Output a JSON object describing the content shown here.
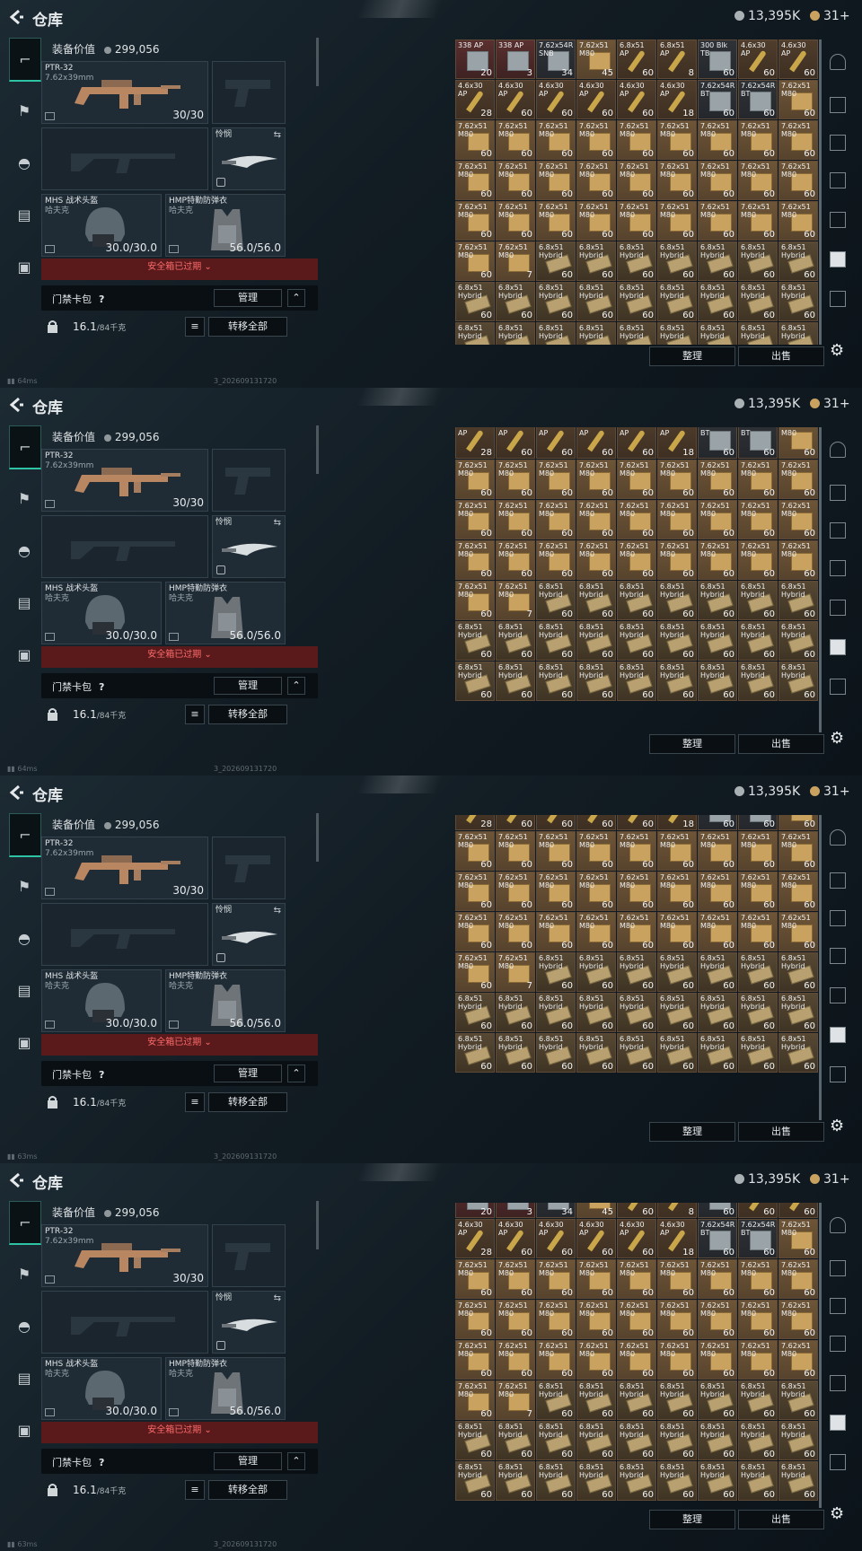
{
  "app": {
    "title": "仓库",
    "silver": "13,395K",
    "gold": "31+"
  },
  "loadout": {
    "value_label": "装备价值",
    "value": "299,056",
    "primary": {
      "name": "PTR-32",
      "caliber": "7.62x39mm",
      "ammo": "30/30"
    },
    "melee": {
      "name": "怜悯"
    },
    "helmet": {
      "name": "MHS 战术头盔",
      "sub": "哈夫克",
      "dur": "30.0/30.0"
    },
    "armor": {
      "name": "HMP特勤防弹衣",
      "sub": "哈夫克",
      "dur": "56.0/56.0"
    },
    "safe_box_text": "安全箱已过期",
    "card_pack": "门禁卡包",
    "help": "?",
    "manage_button": "管理",
    "weight": "16.1",
    "weight_cap": "/84千克",
    "transfer_all_button": "转移全部"
  },
  "stash": {
    "sort_button": "整理",
    "sell_button": "出售"
  },
  "status": {
    "pings": [
      "64ms",
      "64ms",
      "63ms",
      "63ms"
    ],
    "build": "3_202609131720"
  },
  "colors": {
    "accent": "#2ec3a5",
    "warning": "#ff6a6a",
    "crate": "#c9a260"
  },
  "panels": [
    {
      "grid_offset_rows": 0
    },
    {
      "grid_offset_rows": 1.2
    },
    {
      "grid_offset_rows": 1.6
    },
    {
      "grid_offset_rows": 0.6
    }
  ],
  "grid_rows": [
    [
      [
        "338 AP",
        "20",
        "red"
      ],
      [
        "338 AP",
        "3",
        "red"
      ],
      [
        "7.62x54R SNB",
        "34",
        "can"
      ],
      [
        "7.62x51 M80",
        "45",
        "box"
      ],
      [
        "6.8x51 AP",
        "60",
        "ap"
      ],
      [
        "6.8x51 AP",
        "8",
        "ap"
      ],
      [
        "300 Blk TB",
        "60",
        "can"
      ],
      [
        "4.6x30 AP",
        "60",
        "ap"
      ],
      [
        "4.6x30 AP",
        "60",
        "ap"
      ]
    ],
    [
      [
        "4.6x30 AP",
        "28",
        "ap"
      ],
      [
        "4.6x30 AP",
        "60",
        "ap"
      ],
      [
        "4.6x30 AP",
        "60",
        "ap"
      ],
      [
        "4.6x30 AP",
        "60",
        "ap"
      ],
      [
        "4.6x30 AP",
        "60",
        "ap"
      ],
      [
        "4.6x30 AP",
        "18",
        "ap"
      ],
      [
        "7.62x54R BT",
        "60",
        "can"
      ],
      [
        "7.62x54R BT",
        "60",
        "can"
      ],
      [
        "7.62x51 M80",
        "60",
        "box"
      ]
    ],
    [
      [
        "7.62x51 M80",
        "60",
        "box"
      ],
      [
        "7.62x51 M80",
        "60",
        "box"
      ],
      [
        "7.62x51 M80",
        "60",
        "box"
      ],
      [
        "7.62x51 M80",
        "60",
        "box"
      ],
      [
        "7.62x51 M80",
        "60",
        "box"
      ],
      [
        "7.62x51 M80",
        "60",
        "box"
      ],
      [
        "7.62x51 M80",
        "60",
        "box"
      ],
      [
        "7.62x51 M80",
        "60",
        "box"
      ],
      [
        "7.62x51 M80",
        "60",
        "box"
      ]
    ],
    [
      [
        "7.62x51 M80",
        "60",
        "box"
      ],
      [
        "7.62x51 M80",
        "60",
        "box"
      ],
      [
        "7.62x51 M80",
        "60",
        "box"
      ],
      [
        "7.62x51 M80",
        "60",
        "box"
      ],
      [
        "7.62x51 M80",
        "60",
        "box"
      ],
      [
        "7.62x51 M80",
        "60",
        "box"
      ],
      [
        "7.62x51 M80",
        "60",
        "box"
      ],
      [
        "7.62x51 M80",
        "60",
        "box"
      ],
      [
        "7.62x51 M80",
        "60",
        "box"
      ]
    ],
    [
      [
        "7.62x51 M80",
        "60",
        "box"
      ],
      [
        "7.62x51 M80",
        "60",
        "box"
      ],
      [
        "7.62x51 M80",
        "60",
        "box"
      ],
      [
        "7.62x51 M80",
        "60",
        "box"
      ],
      [
        "7.62x51 M80",
        "60",
        "box"
      ],
      [
        "7.62x51 M80",
        "60",
        "box"
      ],
      [
        "7.62x51 M80",
        "60",
        "box"
      ],
      [
        "7.62x51 M80",
        "60",
        "box"
      ],
      [
        "7.62x51 M80",
        "60",
        "box"
      ]
    ],
    [
      [
        "7.62x51 M80",
        "60",
        "box"
      ],
      [
        "7.62x51 M80",
        "7",
        "box"
      ],
      [
        "6.8x51 Hybrid",
        "60",
        "mag"
      ],
      [
        "6.8x51 Hybrid",
        "60",
        "mag"
      ],
      [
        "6.8x51 Hybrid",
        "60",
        "mag"
      ],
      [
        "6.8x51 Hybrid",
        "60",
        "mag"
      ],
      [
        "6.8x51 Hybrid",
        "60",
        "mag"
      ],
      [
        "6.8x51 Hybrid",
        "60",
        "mag"
      ],
      [
        "6.8x51 Hybrid",
        "60",
        "mag"
      ]
    ],
    [
      [
        "6.8x51 Hybrid",
        "60",
        "mag"
      ],
      [
        "6.8x51 Hybrid",
        "60",
        "mag"
      ],
      [
        "6.8x51 Hybrid",
        "60",
        "mag"
      ],
      [
        "6.8x51 Hybrid",
        "60",
        "mag"
      ],
      [
        "6.8x51 Hybrid",
        "60",
        "mag"
      ],
      [
        "6.8x51 Hybrid",
        "60",
        "mag"
      ],
      [
        "6.8x51 Hybrid",
        "60",
        "mag"
      ],
      [
        "6.8x51 Hybrid",
        "60",
        "mag"
      ],
      [
        "6.8x51 Hybrid",
        "60",
        "mag"
      ]
    ],
    [
      [
        "6.8x51 Hybrid",
        "60",
        "mag"
      ],
      [
        "6.8x51 Hybrid",
        "60",
        "mag"
      ],
      [
        "6.8x51 Hybrid",
        "60",
        "mag"
      ],
      [
        "6.8x51 Hybrid",
        "60",
        "mag"
      ],
      [
        "6.8x51 Hybrid",
        "60",
        "mag"
      ],
      [
        "6.8x51 Hybrid",
        "60",
        "mag"
      ],
      [
        "6.8x51 Hybrid",
        "60",
        "mag"
      ],
      [
        "6.8x51 Hybrid",
        "60",
        "mag"
      ],
      [
        "6.8x51 Hybrid",
        "60",
        "mag"
      ]
    ]
  ]
}
